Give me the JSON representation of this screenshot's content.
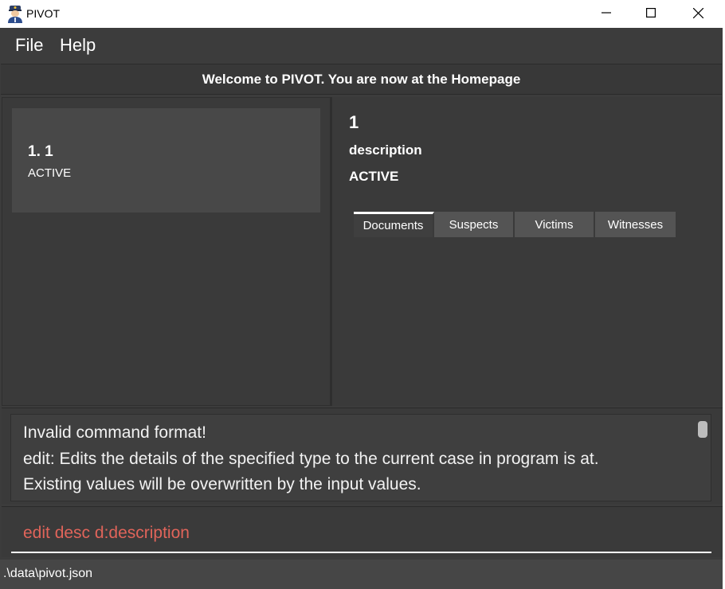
{
  "window": {
    "title": "PIVOT",
    "icon": "police-officer-icon",
    "controls": [
      "minimize-icon",
      "maximize-icon",
      "close-icon"
    ]
  },
  "menu": {
    "file_label": "File",
    "help_label": "Help"
  },
  "welcome": {
    "message": "Welcome to PIVOT. You are now at the Homepage"
  },
  "case_list": {
    "items": [
      {
        "title": "1.  1",
        "status": "ACTIVE"
      }
    ]
  },
  "case_detail": {
    "title": "1",
    "description": "description",
    "status": "ACTIVE",
    "tabs": [
      {
        "label": "Documents",
        "active": true
      },
      {
        "label": "Suspects",
        "active": false
      },
      {
        "label": "Victims",
        "active": false
      },
      {
        "label": "Witnesses",
        "active": false
      }
    ]
  },
  "result_display": {
    "lines": [
      "Invalid command format!",
      "edit: Edits the details of the specified type to the current case in program is at.",
      "Existing values will be overwritten by the input values."
    ]
  },
  "command_box": {
    "value": "edit desc d:description",
    "error_color": "#e0645a"
  },
  "status_bar": {
    "path": ".\\data\\pivot.json"
  },
  "colors": {
    "background": "#3c3c3c",
    "panel": "#3a3a3a",
    "card": "#484848",
    "tab": "#545454",
    "text": "#ffffff"
  }
}
